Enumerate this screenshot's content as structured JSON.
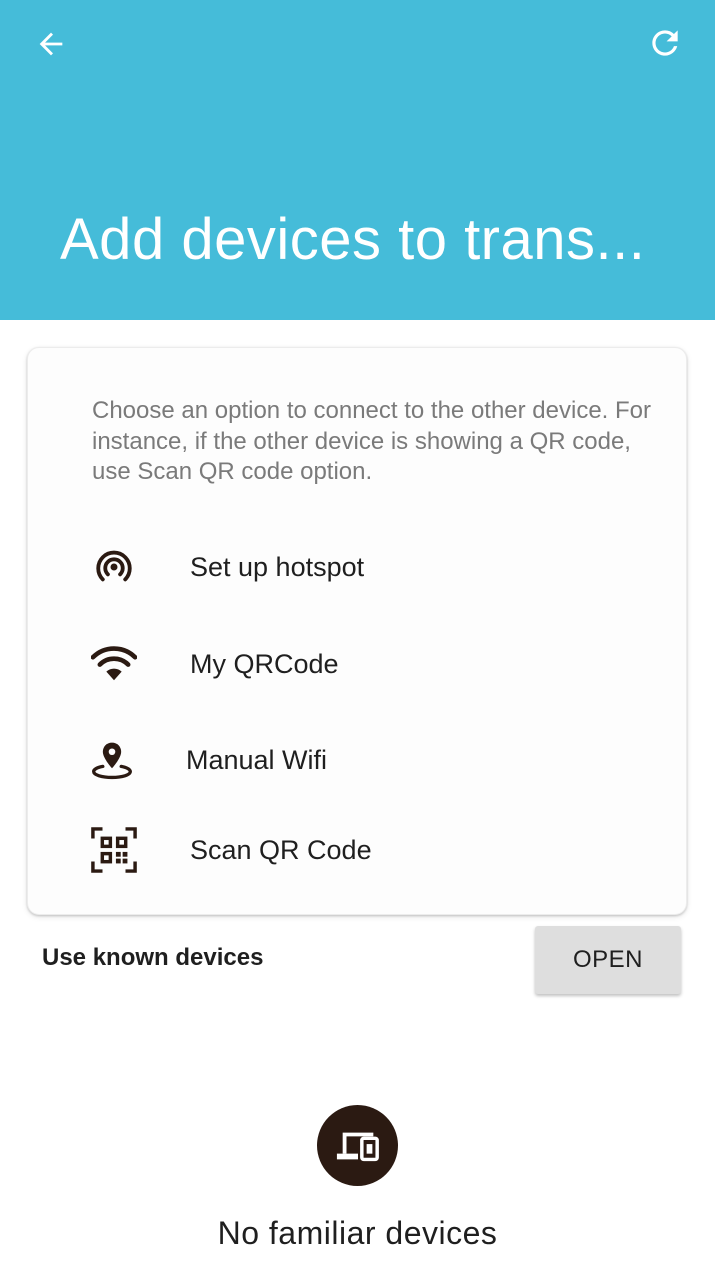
{
  "header": {
    "title": "Add devices to trans...",
    "back_icon": "arrow-left-icon",
    "refresh_icon": "refresh-icon",
    "background_color": "#45bcd9"
  },
  "card": {
    "intro": "Choose an option to connect to the other device. For instance, if the other device is showing a QR code, use Scan QR code option.",
    "options": [
      {
        "label": "Set up hotspot",
        "icon": "hotspot-icon"
      },
      {
        "label": "My QRCode",
        "icon": "wifi-icon"
      },
      {
        "label": "Manual Wifi",
        "icon": "location-pin-icon"
      },
      {
        "label": "Scan QR Code",
        "icon": "qr-code-icon"
      }
    ]
  },
  "known_devices": {
    "label": "Use known devices",
    "button_label": "OPEN"
  },
  "empty_state": {
    "icon": "devices-icon",
    "text": "No familiar devices",
    "icon_color": "#2b1a12"
  }
}
